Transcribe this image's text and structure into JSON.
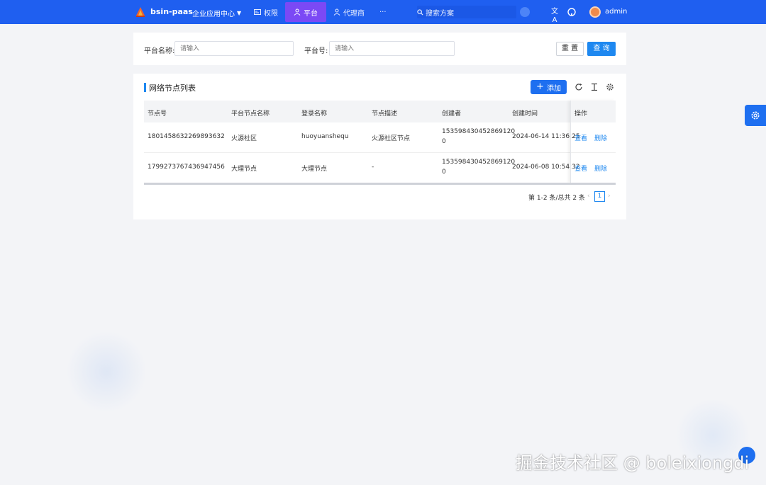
{
  "header": {
    "brand": "bsin-paas",
    "app_center": "企业应用中心",
    "nav": [
      {
        "label": "权限"
      },
      {
        "label": "平台"
      },
      {
        "label": "代理商"
      },
      {
        "label": "···"
      }
    ],
    "search_placeholder": "搜索方案",
    "user": "admin"
  },
  "filter": {
    "platform_name_label": "平台名称:",
    "platform_name_placeholder": "请输入",
    "platform_no_label": "平台号:",
    "platform_no_placeholder": "请输入",
    "reset": "重 置",
    "query": "查 询"
  },
  "list": {
    "title": "网络节点列表",
    "add": "添加",
    "columns": [
      "节点号",
      "平台节点名称",
      "登录名称",
      "节点描述",
      "创建者",
      "创建时间",
      "操作"
    ],
    "rows": [
      {
        "node_no": "1801458632269893632",
        "name": "火源社区",
        "login": "huoyuanshequ",
        "desc": "火源社区节点",
        "creator_a": "153598430452869120",
        "creator_b": "0",
        "created": "2024-06-14 11:36:25",
        "view": "查看",
        "delete": "删除"
      },
      {
        "node_no": "1799273767436947456",
        "name": "大理节点",
        "login": "大理节点",
        "desc": "-",
        "creator_a": "153598430452869120",
        "creator_b": "0",
        "created": "2024-06-08 10:54:32",
        "view": "查看",
        "delete": "删除"
      }
    ],
    "pager_text": "第 1-2 条/总共 2 条",
    "page": "1",
    "prev": "‹",
    "next": "›"
  },
  "watermark": "掘金技术社区 @ boleixiongdi",
  "colors": {
    "header": "#1f5ff0",
    "active_nav": "#7b49f5",
    "primary": "#1e88f0"
  }
}
